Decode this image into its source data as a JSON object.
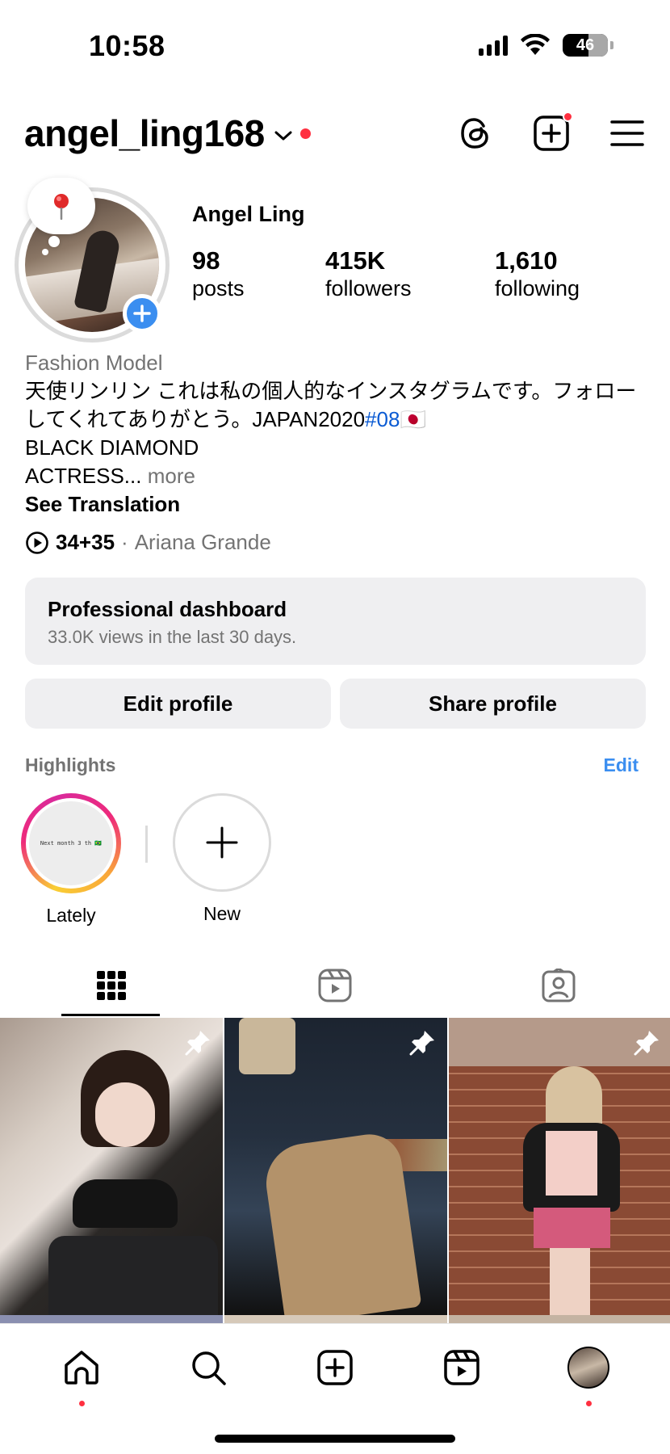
{
  "status_bar": {
    "time": "10:58",
    "battery": "46"
  },
  "header": {
    "username": "angel_ling168"
  },
  "profile": {
    "display_name": "Angel Ling",
    "stats": [
      {
        "value": "98",
        "label": "posts"
      },
      {
        "value": "415K",
        "label": "followers"
      },
      {
        "value": "1,610",
        "label": "following"
      }
    ],
    "note_icon": "pushpin-icon"
  },
  "bio": {
    "category": "Fashion Model",
    "line1_text": "天使リンリン これは私の個人的なインスタグラムです。フォローしてくれてありがとう。JAPAN2020",
    "hashtag": "#08",
    "flag": "🇯🇵",
    "line2": "BLACK DIAMOND",
    "line3": "ACTRESS...",
    "more": "more",
    "translate": "See Translation"
  },
  "music": {
    "song": "34+35",
    "separator": "·",
    "artist": "Ariana Grande"
  },
  "dashboard": {
    "title": "Professional dashboard",
    "subtitle": "33.0K views in the last 30 days."
  },
  "buttons": {
    "edit": "Edit profile",
    "share": "Share profile"
  },
  "highlights": {
    "title": "Highlights",
    "edit": "Edit",
    "items": [
      {
        "label": "Lately",
        "cover_text": "Next month 3 th 🇧🇷"
      },
      {
        "label": "New"
      }
    ]
  },
  "tabs": [
    "grid-tab",
    "reels-tab",
    "tagged-tab"
  ],
  "posts": [
    {
      "pinned": true
    },
    {
      "pinned": true
    },
    {
      "pinned": true
    }
  ],
  "colors": {
    "accent": "#3b8ef0",
    "notification": "#ff3040",
    "muted": "#737373",
    "hashtag": "#0b5bd3",
    "button_bg": "#efeff1"
  },
  "bottom_nav": [
    "home-icon",
    "search-icon",
    "create-icon",
    "reels-icon",
    "profile-avatar"
  ]
}
